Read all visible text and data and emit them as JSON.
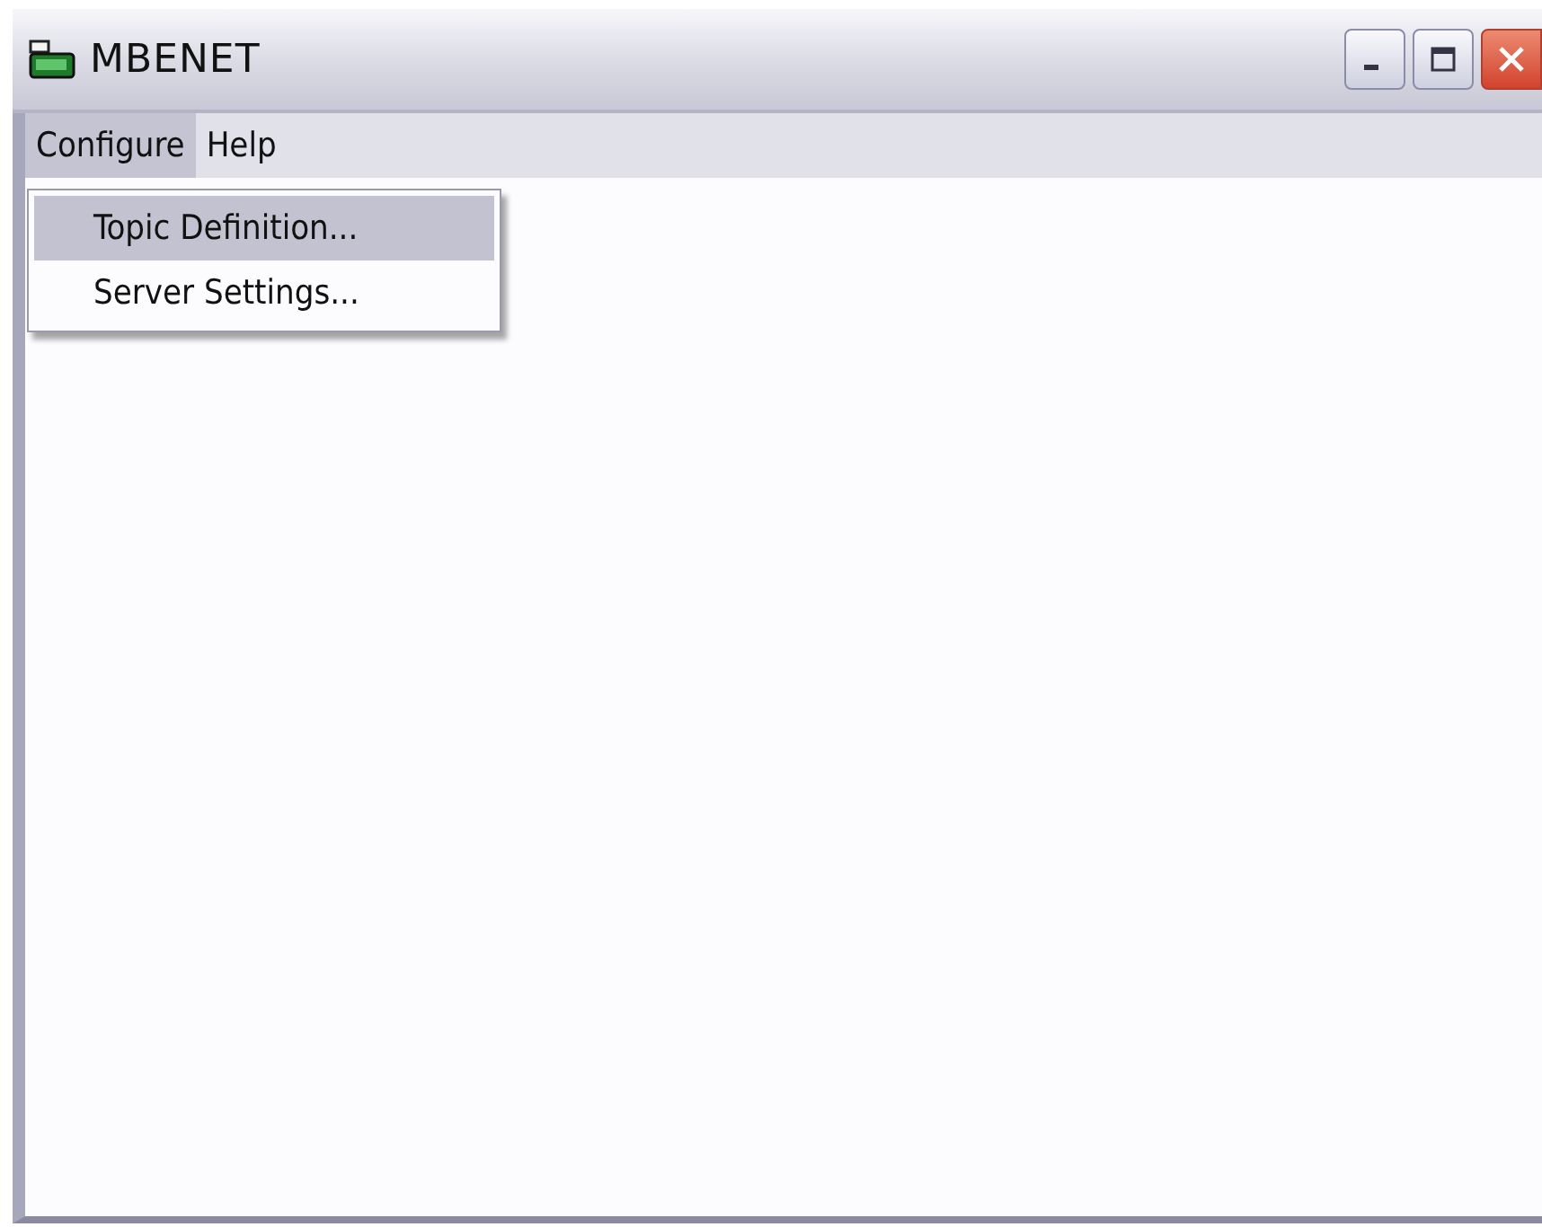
{
  "window": {
    "title": "MBENET"
  },
  "menu_bar": [
    {
      "label": "Configure",
      "selected": true
    },
    {
      "label": "Help",
      "selected": false
    }
  ],
  "dropdown": [
    {
      "label": "Topic Definition...",
      "selected": true
    },
    {
      "label": "Server Settings...",
      "selected": false
    }
  ]
}
